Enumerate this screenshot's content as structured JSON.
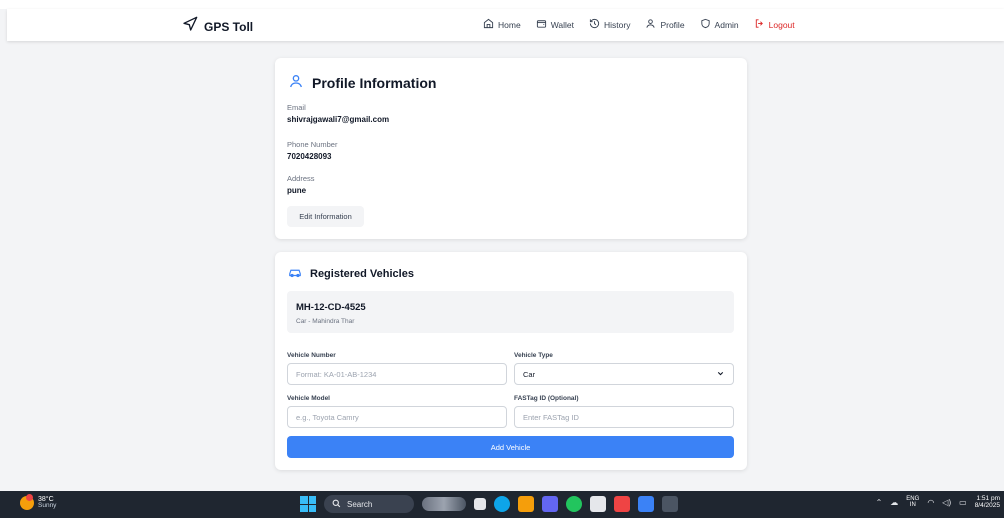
{
  "brand": {
    "name": "GPS Toll",
    "icon": "navigation-arrow-icon"
  },
  "nav": {
    "items": [
      {
        "label": "Home",
        "icon": "home-icon"
      },
      {
        "label": "Wallet",
        "icon": "wallet-icon"
      },
      {
        "label": "History",
        "icon": "history-icon"
      },
      {
        "label": "Profile",
        "icon": "user-icon"
      },
      {
        "label": "Admin",
        "icon": "shield-icon"
      },
      {
        "label": "Logout",
        "icon": "logout-icon"
      }
    ]
  },
  "profile": {
    "title": "Profile Information",
    "email_label": "Email",
    "email": "shivrajgawali7@gmail.com",
    "phone_label": "Phone Number",
    "phone": "7020428093",
    "address_label": "Address",
    "address": "pune",
    "edit_label": "Edit Information"
  },
  "vehicles": {
    "title": "Registered Vehicles",
    "items": [
      {
        "number": "MH-12-CD-4525",
        "description": "Car - Mahindra Thar"
      }
    ],
    "form": {
      "number_label": "Vehicle Number",
      "number_placeholder": "Format: KA-01-AB-1234",
      "type_label": "Vehicle Type",
      "type_value": "Car",
      "model_label": "Vehicle Model",
      "model_placeholder": "e.g., Toyota Camry",
      "fastag_label": "FASTag ID (Optional)",
      "fastag_placeholder": "Enter FASTag ID",
      "submit_label": "Add Vehicle"
    }
  },
  "taskbar": {
    "weather_temp": "38°C",
    "weather_condition": "Sunny",
    "search_label": "Search",
    "lang_top": "ENG",
    "lang_bottom": "IN",
    "time": "1:51 pm",
    "date": "8/4/2025"
  },
  "colors": {
    "accent": "#3b82f6",
    "logout": "#dc2626",
    "background": "#f3f4f6",
    "taskbar": "#1f2630"
  }
}
